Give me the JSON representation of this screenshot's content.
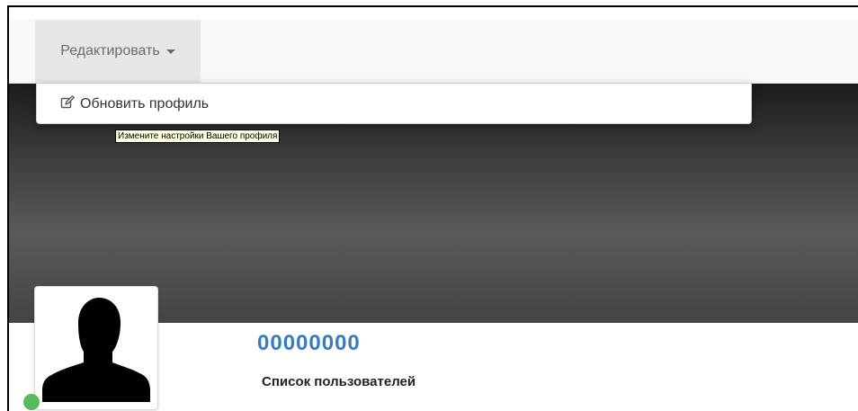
{
  "navbar": {
    "edit_menu_label": "Редактировать",
    "caret_icon": "caret-down"
  },
  "dropdown": {
    "items": [
      {
        "icon": "edit-icon",
        "label": "Обновить профиль"
      }
    ]
  },
  "tooltip": {
    "text": "Измените настройки Вашего профиля"
  },
  "profile": {
    "avatar": "user-silhouette",
    "status_color": "#5cb85c",
    "user_id": "00000000",
    "user_list_link": "Список пользователей"
  },
  "colors": {
    "link_blue": "#3a7bbf",
    "status_online": "#5cb85c"
  }
}
